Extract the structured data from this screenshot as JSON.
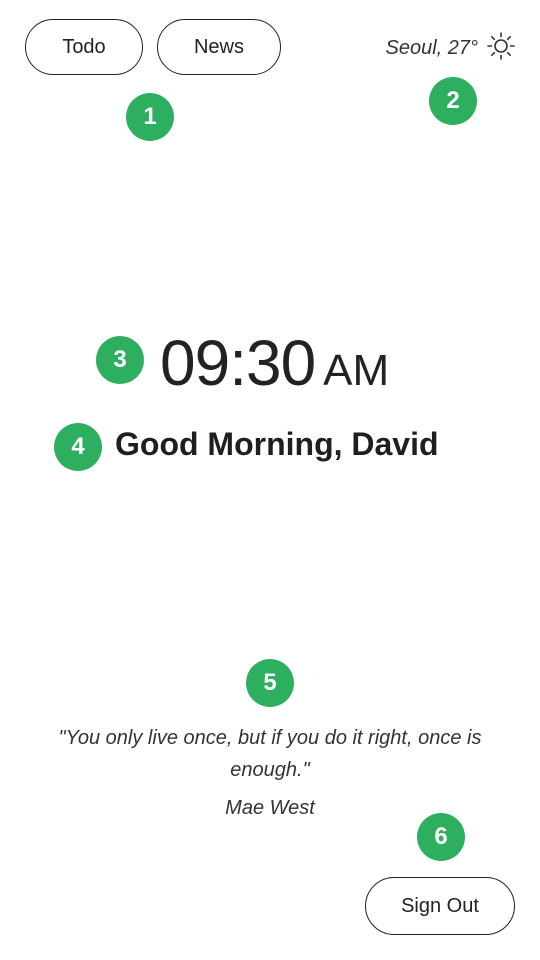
{
  "nav": {
    "todo_label": "Todo",
    "news_label": "News"
  },
  "weather": {
    "label": "Seoul, 27°",
    "icon": "sun-icon"
  },
  "clock": {
    "time": "09:30",
    "period": "AM"
  },
  "greeting": "Good Morning, David",
  "quote": {
    "text": "\"You only live once, but if you do it right, once is enough.\"",
    "author": "Mae West"
  },
  "footer": {
    "signout_label": "Sign Out"
  },
  "badges": [
    "1",
    "2",
    "3",
    "4",
    "5",
    "6"
  ],
  "colors": {
    "badge": "#2eae5f",
    "text": "#222222",
    "background": "#ffffff"
  }
}
